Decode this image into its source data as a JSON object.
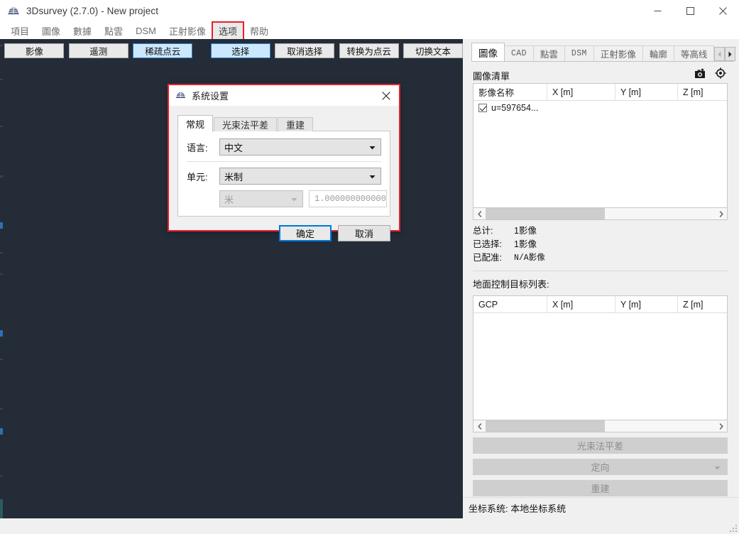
{
  "window": {
    "title": "3Dsurvey (2.7.0) - New project",
    "app_icon": "3dsurvey-logo-icon",
    "controls": {
      "minimize": "minimize-icon",
      "maximize": "maximize-icon",
      "close": "close-icon"
    }
  },
  "menubar": {
    "items": [
      {
        "label": "項目",
        "highlighted": false
      },
      {
        "label": "圖像",
        "highlighted": false
      },
      {
        "label": "數據",
        "highlighted": false
      },
      {
        "label": "點雲",
        "highlighted": false
      },
      {
        "label": "DSM",
        "highlighted": false
      },
      {
        "label": "正射影像",
        "highlighted": false
      },
      {
        "label": "选项",
        "highlighted": true
      },
      {
        "label": "帮助",
        "highlighted": false
      }
    ],
    "highlight_color": "#e8202a"
  },
  "toolbar": {
    "buttons": [
      {
        "label": "影像",
        "selected": false
      },
      {
        "label": "遥测",
        "selected": false
      },
      {
        "label": "稀疏点云",
        "selected": true
      },
      {
        "label": "选择",
        "selected": true
      },
      {
        "label": "取消选择",
        "selected": false
      },
      {
        "label": "转换为点云",
        "selected": false
      },
      {
        "label": "切换文本",
        "selected": false
      }
    ],
    "selected_color": "#cce8ff"
  },
  "viewport": {
    "background_color": "#242c38"
  },
  "right_panel": {
    "tabs": [
      {
        "label": "圖像",
        "active": true,
        "mono": false
      },
      {
        "label": "CAD",
        "active": false,
        "mono": true
      },
      {
        "label": "點雲",
        "active": false,
        "mono": false
      },
      {
        "label": "DSM",
        "active": false,
        "mono": true
      },
      {
        "label": "正射影像",
        "active": false,
        "mono": false
      },
      {
        "label": "輪廓",
        "active": false,
        "mono": false
      },
      {
        "label": "等高线",
        "active": false,
        "mono": false
      }
    ],
    "tab_scroll": {
      "left": "chevron-left-icon",
      "right": "chevron-right-icon"
    },
    "image_list": {
      "title": "圖像清單",
      "icons": [
        "add-camera-icon",
        "target-icon"
      ],
      "columns": [
        "影像名称",
        "X [m]",
        "Y [m]",
        "Z [m]"
      ],
      "rows": [
        {
          "checked": true,
          "name": "u=597654...",
          "x": "",
          "y": "",
          "z": ""
        }
      ]
    },
    "stats": [
      {
        "key": "总计:",
        "value": "1影像"
      },
      {
        "key": "已选择:",
        "value": "1影像"
      },
      {
        "key": "已配准:",
        "value": "N/A影像"
      }
    ],
    "gcp_list": {
      "title": "地面控制目标列表:",
      "columns": [
        "GCP",
        "X [m]",
        "Y [m]",
        "Z [m]"
      ],
      "rows": []
    },
    "actions": [
      {
        "label": "光束法平差",
        "enabled": false,
        "dropdown": false
      },
      {
        "label": "定向",
        "enabled": false,
        "dropdown": true
      },
      {
        "label": "重建",
        "enabled": false,
        "dropdown": false
      }
    ],
    "status": "坐标系统: 本地坐标系统"
  },
  "dialog": {
    "icon": "3dsurvey-logo-icon",
    "title": "系统设置",
    "close_icon": "close-icon",
    "tabs": [
      {
        "label": "常规",
        "active": true
      },
      {
        "label": "光束法平差",
        "active": false
      },
      {
        "label": "重建",
        "active": false
      }
    ],
    "fields": {
      "language_label": "语言:",
      "language_value": "中文",
      "unit_label": "单元:",
      "unit_value": "米制",
      "unit_sub_value": "米",
      "unit_factor": "1.000000000000"
    },
    "buttons": [
      {
        "label": "确定",
        "default": true
      },
      {
        "label": "取消",
        "default": false
      }
    ],
    "border_color": "#e8202a",
    "focus_color": "#0078d7"
  }
}
